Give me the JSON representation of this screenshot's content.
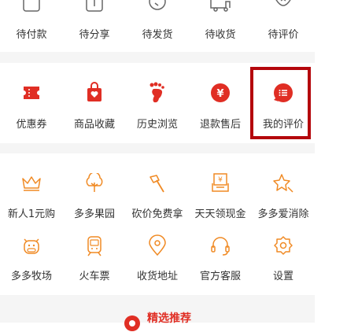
{
  "orders": {
    "items": [
      {
        "label": "待付款",
        "icon": "wallet-icon"
      },
      {
        "label": "待分享",
        "icon": "share-icon"
      },
      {
        "label": "待发货",
        "icon": "clock-icon"
      },
      {
        "label": "待收货",
        "icon": "truck-icon"
      },
      {
        "label": "待评价",
        "icon": "review-icon"
      }
    ]
  },
  "services": {
    "items": [
      {
        "label": "优惠券",
        "icon": "coupon-icon"
      },
      {
        "label": "商品收藏",
        "icon": "favorite-bag-icon"
      },
      {
        "label": "历史浏览",
        "icon": "footprint-icon"
      },
      {
        "label": "退款售后",
        "icon": "refund-icon"
      },
      {
        "label": "我的评价",
        "icon": "my-review-icon"
      }
    ]
  },
  "tools": {
    "row1": [
      {
        "label": "新人1元购",
        "icon": "crown-icon"
      },
      {
        "label": "多多果园",
        "icon": "tree-icon"
      },
      {
        "label": "砍价免费拿",
        "icon": "axe-icon"
      },
      {
        "label": "天天领现金",
        "icon": "cash-icon"
      },
      {
        "label": "多多爱消除",
        "icon": "star-icon"
      }
    ],
    "row2": [
      {
        "label": "多多牧场",
        "icon": "cow-icon"
      },
      {
        "label": "火车票",
        "icon": "train-icon"
      },
      {
        "label": "收货地址",
        "icon": "location-icon"
      },
      {
        "label": "官方客服",
        "icon": "headset-icon"
      },
      {
        "label": "设置",
        "icon": "gear-icon"
      }
    ]
  },
  "recommend": {
    "title": "精选推荐"
  },
  "colors": {
    "brand_red": "#e02e24",
    "orange": "#f08a24",
    "highlight": "#b4070c"
  }
}
